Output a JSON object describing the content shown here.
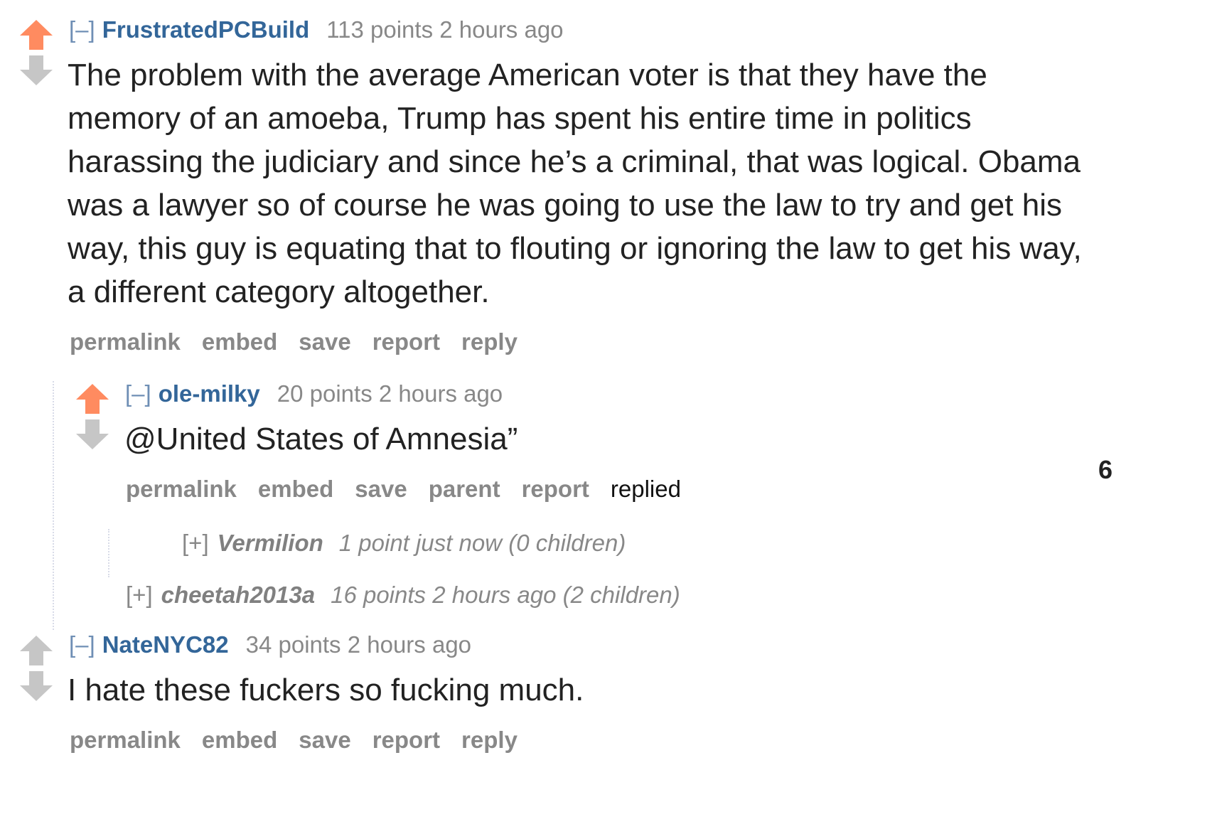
{
  "comments": [
    {
      "toggle": "[–]",
      "author": "FrustratedPCBuild",
      "meta": "113 points 2 hours ago",
      "body": "The problem with the average American voter is that they have the memory of an amoeba, Trump has spent his entire time in politics harassing the judiciary and since he’s a criminal, that was logical. Obama was a lawyer so of course he was going to use the law to try and get his way, this guy is equating that to flouting or ignoring the law to get his way, a different category altogether.",
      "vote": "upvoted",
      "buttons": [
        "permalink",
        "embed",
        "save",
        "report",
        "reply"
      ]
    },
    {
      "toggle": "[–]",
      "author": "ole-milky",
      "meta": "20 points 2 hours ago",
      "body": "@United States of Amnesia”",
      "vote": "upvoted",
      "buttons": [
        "permalink",
        "embed",
        "save",
        "parent",
        "report"
      ],
      "replied_label": "replied"
    },
    {
      "toggle": "[–]",
      "author": "NateNYC82",
      "meta": "34 points 2 hours ago",
      "body": "I hate these fuckers so fucking much.",
      "vote": "none",
      "buttons": [
        "permalink",
        "embed",
        "save",
        "report",
        "reply"
      ]
    }
  ],
  "collapsed": [
    {
      "toggle": "[+]",
      "author": "Vermilion",
      "meta": "1 point just now (0 children)"
    },
    {
      "toggle": "[+]",
      "author": "cheetah2013a",
      "meta": "16 points 2 hours ago (2 children)"
    }
  ],
  "side_number": "6",
  "colors": {
    "upvote": "#ff8b60",
    "neutral_arrow": "#c6c6c6",
    "author": "#336699",
    "muted": "#888888"
  }
}
